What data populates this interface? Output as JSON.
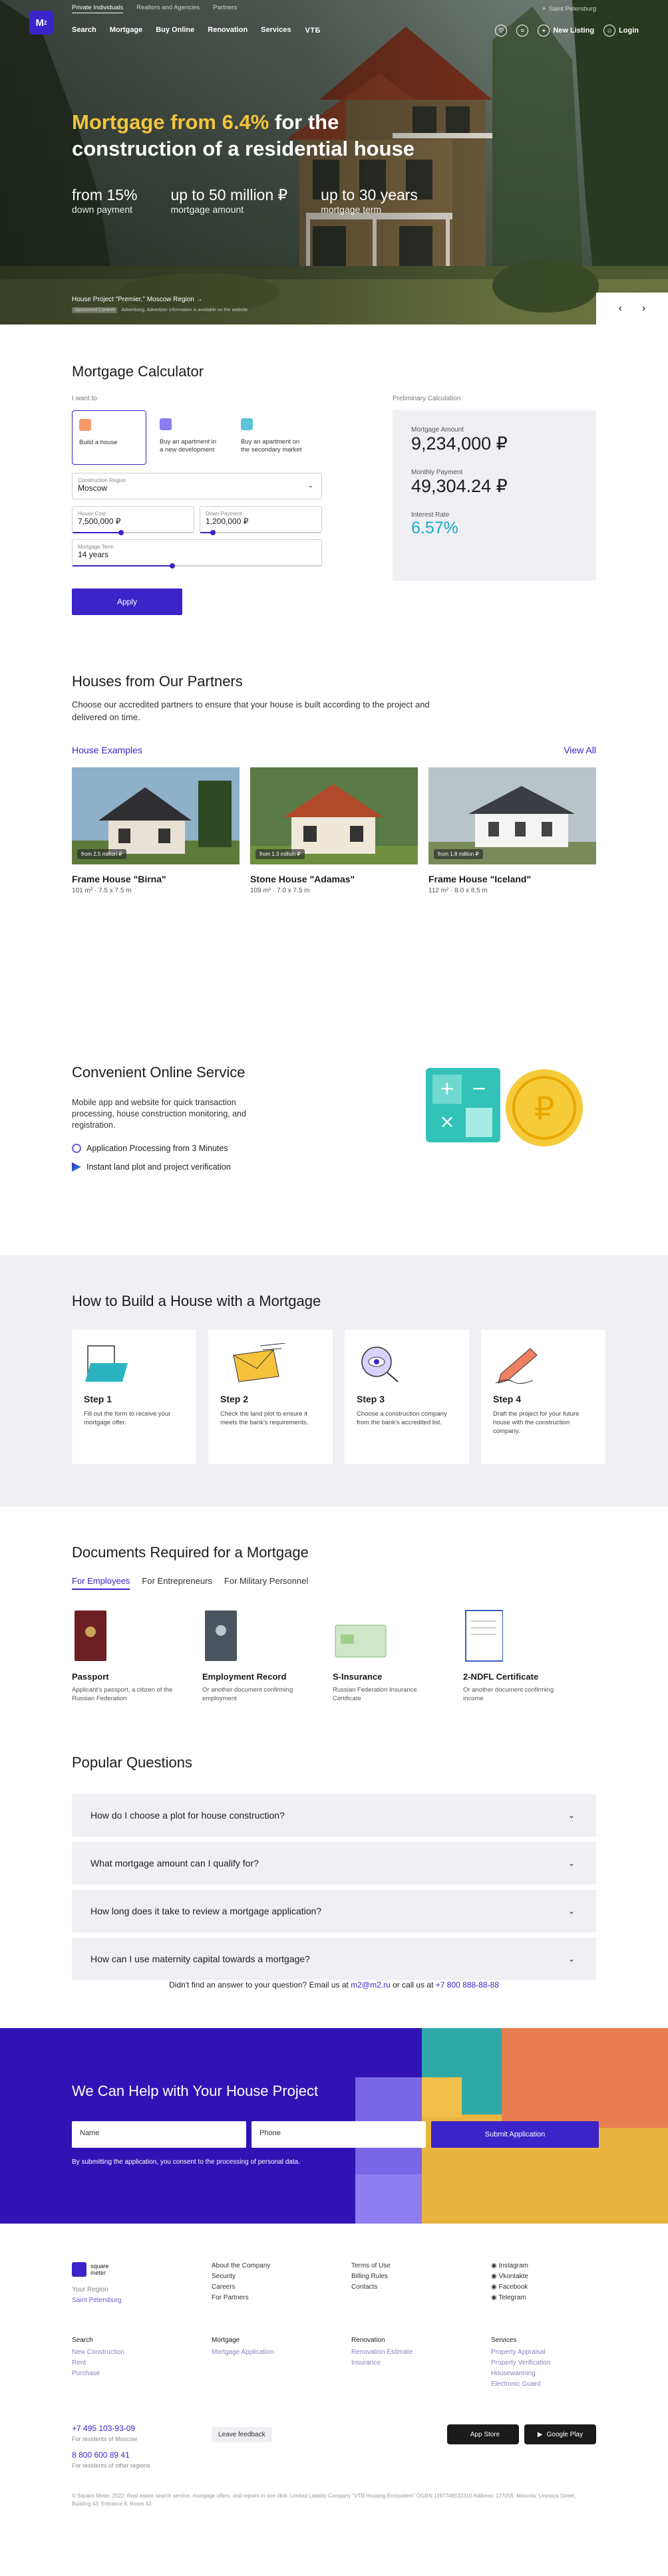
{
  "topbar": {
    "segments": [
      "Private Individuals",
      "Realtors and Agencies",
      "Partners"
    ],
    "city": "Saint Petersburg"
  },
  "logo": {
    "text": "M",
    "sup": "2"
  },
  "nav": {
    "links": [
      "Search",
      "Mortgage",
      "Buy Online",
      "Renovation",
      "Services"
    ],
    "vtb": "VTБ",
    "new_listing": "New Listing",
    "login": "Login"
  },
  "hero": {
    "title_highlight": "Mortgage from 6.4%",
    "title_rest": " for the construction of a residential house",
    "stats": [
      {
        "value": "from 15%",
        "label": "down payment"
      },
      {
        "value": "up to 50 million ₽",
        "label": "mortgage amount"
      },
      {
        "value": "up to 30 years",
        "label": "mortgage term"
      }
    ],
    "project": "House Project \"Premier,\" Moscow Region →",
    "project_tag": "Sponsored Content",
    "project_sub": "Advertising. Advertiser information is available on the website"
  },
  "calc": {
    "title": "Mortgage Calculator",
    "want_label": "I want to",
    "choices": [
      "Build a house",
      "Buy an apartment in a new development",
      "Buy an apartment on the secondary market"
    ],
    "region_label": "Construction Region",
    "region_value": "Moscow",
    "cost_label": "House Cost",
    "cost_value": "7,500,000 ₽",
    "down_label": "Down Payment",
    "down_value": "1,200,000 ₽",
    "term_label": "Mortgage Term",
    "term_value": "14 years",
    "apply": "Apply",
    "prelim_label": "Preliminary Calculation",
    "amount_label": "Mortgage Amount",
    "amount_value": "9,234,000 ₽",
    "monthly_label": "Monthly Payment",
    "monthly_value": "49,304.24 ₽",
    "rate_label": "Interest Rate",
    "rate_value": "6.57%",
    "accent": "#3b24c8",
    "rate_color": "#18a9c5"
  },
  "houses": {
    "title": "Houses from Our Partners",
    "desc": "Choose our accredited partners to ensure that your house is built according to the project and delivered on time.",
    "examples_label": "House Examples",
    "view_all": "View All",
    "items": [
      {
        "price": "from 2.5 million ₽",
        "name": "Frame House \"Birna\"",
        "area": "101 m²",
        "size": "7.5 x 7.5 m"
      },
      {
        "price": "from 1.3 million ₽",
        "name": "Stone House \"Adamas\"",
        "area": "109 m²",
        "size": "7.0 x 7.5 m"
      },
      {
        "price": "from 1.8 million ₽",
        "name": "Frame House \"Iceland\"",
        "area": "112 m²",
        "size": "8.0 x 8.5 m"
      }
    ]
  },
  "service": {
    "title": "Convenient Online Service",
    "desc": "Mobile app and website for quick transaction processing, house construction monitoring, and registration.",
    "features": [
      "Application Processing from 3 Minutes",
      "Instant land plot and project verification"
    ]
  },
  "steps": {
    "title": "How to Build a House with a Mortgage",
    "items": [
      {
        "title": "Step 1",
        "text": "Fill out the form to receive your mortgage offer."
      },
      {
        "title": "Step 2",
        "text": "Check the land plot to ensure it meets the bank's requirements."
      },
      {
        "title": "Step 3",
        "text": "Choose a construction company from the bank's accredited list."
      },
      {
        "title": "Step 4",
        "text": "Draft the project for your future house with the construction company."
      }
    ]
  },
  "docs": {
    "title": "Documents Required for a Mortgage",
    "tabs": [
      "For Employees",
      "For Entrepreneurs",
      "For Military Personnel"
    ],
    "items": [
      {
        "title": "Passport",
        "text": "Applicant's passport, a citizen of the Russian Federation"
      },
      {
        "title": "Employment Record",
        "text": "Or another document confirming employment"
      },
      {
        "title": "S-Insurance",
        "text": "Russian Federation Insurance Certificate"
      },
      {
        "title": "2-NDFL Certificate",
        "text": "Or another document confirming income"
      }
    ]
  },
  "faq": {
    "title": "Popular Questions",
    "items": [
      "How do I choose a plot for house construction?",
      "What mortgage amount can I qualify for?",
      "How long does it take to review a mortgage application?",
      "How can I use maternity capital towards a mortgage?"
    ],
    "ask_pre": "Didn't find an answer to your question? Email us at ",
    "ask_email": "m2@m2.ru",
    "ask_mid": " or call us at ",
    "ask_phone": "+7 800 888-88-88"
  },
  "cta": {
    "title": "We Can Help with Your House Project",
    "name_ph": "Name",
    "phone_ph": "Phone",
    "submit": "Submit Application",
    "consent": "By submitting the application, you consent to the processing of personal data."
  },
  "footer": {
    "brand_line1": "square",
    "brand_line2": "meter",
    "region_label": "Your Region",
    "region_value": "Saint Petersburg",
    "col1": [
      "About the Company",
      "Security",
      "Careers",
      "For Partners"
    ],
    "col2": [
      "Terms of Use",
      "Billing Rules",
      "Contacts"
    ],
    "social": [
      "Instagram",
      "Vkontakte",
      "Facebook",
      "Telegram"
    ],
    "search": {
      "title": "Search",
      "items": [
        "New Construction",
        "Rent",
        "Purchase"
      ]
    },
    "mortgage": {
      "title": "Mortgage",
      "items": [
        "Mortgage Application"
      ]
    },
    "renovation": {
      "title": "Renovation",
      "items": [
        "Renovation Estimate",
        "Insurance"
      ]
    },
    "services": {
      "title": "Services",
      "items": [
        "Property Appraisal",
        "Property Verification",
        "Housewarming",
        "Electronic Guard"
      ]
    },
    "phone1": "+7 495 103-93-09",
    "phone1_sub": "For residents of Moscow",
    "phone2": "8 800 600 89 41",
    "phone2_sub": "For residents of other regions",
    "feedback": "Leave feedback",
    "appstore": "App Store",
    "googleplay": "Google Play",
    "legal": "© Square Meter, 2022. Real estate search service, mortgage offers, and repairs in one click. Limited Liability Company \"VTB Housing Ecosystem\" OGRN 1197746532310 Address: 127055, Moscow, Lesnaya Street, Building 43, Entrance 8, Room 43."
  }
}
